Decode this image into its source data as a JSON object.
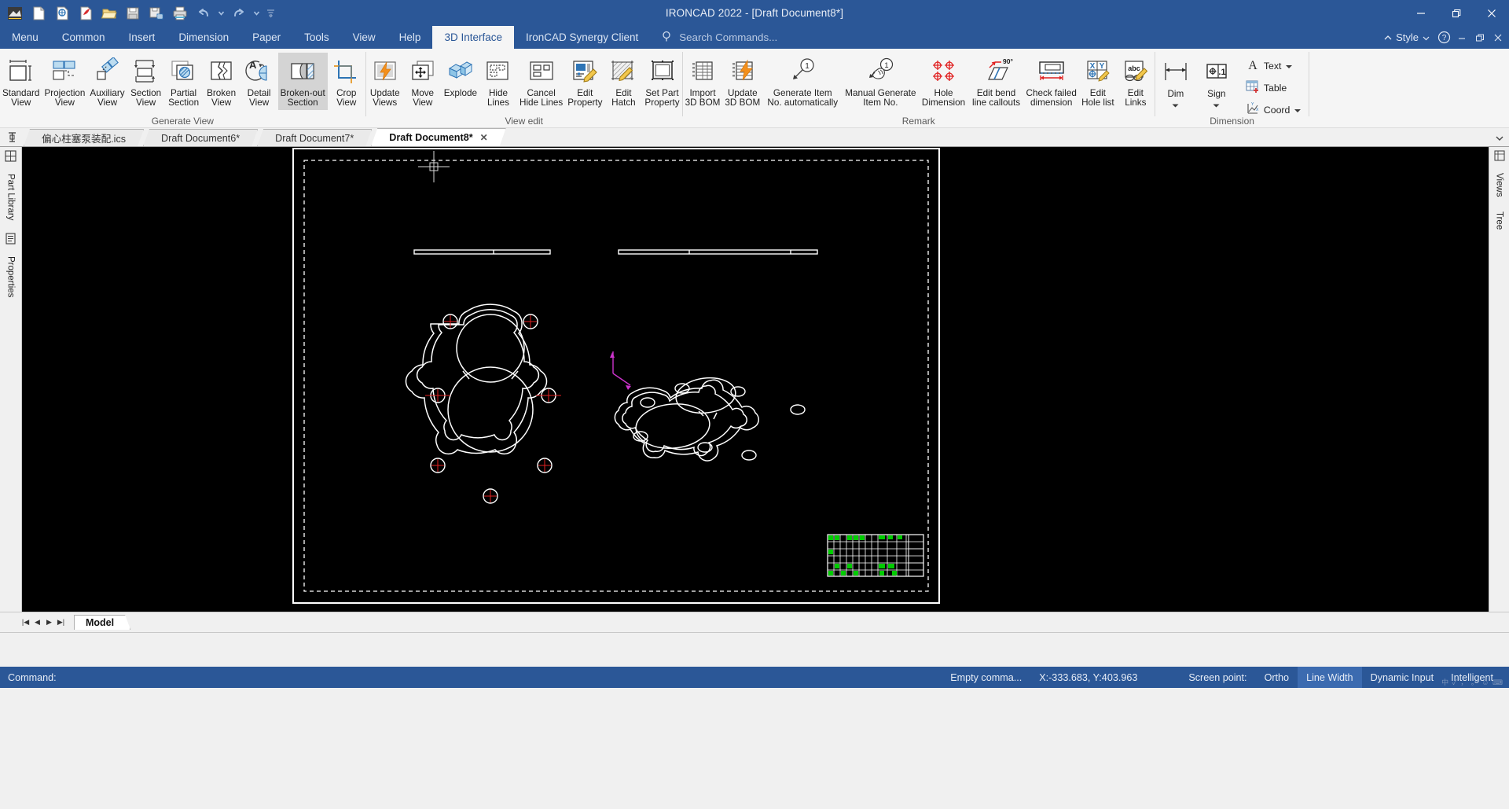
{
  "window": {
    "title": "IRONCAD 2022 - [Draft Document8*]",
    "minimize": "–",
    "restore": "❐",
    "close": "✕"
  },
  "quick_access": [
    {
      "name": "app-logo-icon",
      "label": "IronCAD"
    },
    {
      "name": "new-document-icon",
      "label": "New"
    },
    {
      "name": "new-drawing-icon",
      "label": "New Drawing"
    },
    {
      "name": "new-sheet-icon",
      "label": "New Sheet"
    },
    {
      "name": "open-folder-icon",
      "label": "Open"
    },
    {
      "name": "save-icon",
      "label": "Save"
    },
    {
      "name": "save-as-icon",
      "label": "Save As"
    },
    {
      "name": "print-icon",
      "label": "Print"
    },
    {
      "name": "undo-icon",
      "label": "Undo"
    },
    {
      "name": "undo-dropdown-icon",
      "label": "Undo History"
    },
    {
      "name": "redo-icon",
      "label": "Redo"
    },
    {
      "name": "redo-dropdown-icon",
      "label": "Redo History"
    },
    {
      "name": "customize-qat-icon",
      "label": "Customize Quick Access Toolbar"
    }
  ],
  "menubar": {
    "items": [
      {
        "label": "Menu",
        "active": false
      },
      {
        "label": "Common",
        "active": false
      },
      {
        "label": "Insert",
        "active": false
      },
      {
        "label": "Dimension",
        "active": false
      },
      {
        "label": "Paper",
        "active": false
      },
      {
        "label": "Tools",
        "active": false
      },
      {
        "label": "View",
        "active": false
      },
      {
        "label": "Help",
        "active": false
      },
      {
        "label": "3D Interface",
        "active": true
      },
      {
        "label": "IronCAD Synergy Client",
        "active": false
      }
    ],
    "search_placeholder": "Search Commands...",
    "style_label": "Style",
    "help_label": "?",
    "min_label": "–",
    "restore_label": "❐",
    "close_label": "✕"
  },
  "ribbon": {
    "groups": [
      {
        "label": "Generate View",
        "buttons": [
          {
            "label": "Standard\nView",
            "icon": "standard-view-icon",
            "selected": false
          },
          {
            "label": "Projection\nView",
            "icon": "projection-view-icon",
            "selected": false
          },
          {
            "label": "Auxiliary\nView",
            "icon": "auxiliary-view-icon",
            "selected": false
          },
          {
            "label": "Section\nView",
            "icon": "section-view-icon",
            "selected": false
          },
          {
            "label": "Partial\nSection",
            "icon": "partial-section-icon",
            "selected": false
          },
          {
            "label": "Broken\nView",
            "icon": "broken-view-icon",
            "selected": false
          },
          {
            "label": "Detail\nView",
            "icon": "detail-view-icon",
            "selected": false
          },
          {
            "label": "Broken-out\nSection",
            "icon": "broken-out-section-icon",
            "selected": true
          },
          {
            "label": "Crop\nView",
            "icon": "crop-view-icon",
            "selected": false
          }
        ]
      },
      {
        "label": "View edit",
        "buttons": [
          {
            "label": "Update\nViews",
            "icon": "update-views-icon",
            "selected": false
          },
          {
            "label": "Move\nView",
            "icon": "move-view-icon",
            "selected": false
          },
          {
            "label": "Explode",
            "icon": "explode-icon",
            "selected": false
          },
          {
            "label": "Hide\nLines",
            "icon": "hide-lines-icon",
            "selected": false
          },
          {
            "label": "Cancel\nHide Lines",
            "icon": "cancel-hide-lines-icon",
            "selected": false
          },
          {
            "label": "Edit\nProperty",
            "icon": "edit-property-icon",
            "selected": false
          },
          {
            "label": "Edit\nHatch",
            "icon": "edit-hatch-icon",
            "selected": false
          },
          {
            "label": "Set Part\nProperty",
            "icon": "set-part-property-icon",
            "selected": false
          }
        ]
      },
      {
        "label": "Remark",
        "buttons": [
          {
            "label": "Import\n3D BOM",
            "icon": "import-3d-bom-icon",
            "selected": false
          },
          {
            "label": "Update\n3D BOM",
            "icon": "update-3d-bom-icon",
            "selected": false
          },
          {
            "label": "Generate Item\nNo. automatically",
            "icon": "generate-item-no-icon",
            "selected": false
          },
          {
            "label": "Manual Generate\nItem No.",
            "icon": "manual-generate-item-no-icon",
            "selected": false
          },
          {
            "label": "Hole\nDimension",
            "icon": "hole-dimension-icon",
            "selected": false
          },
          {
            "label": "Edit bend\nline callouts",
            "icon": "edit-bend-line-callouts-icon",
            "selected": false
          },
          {
            "label": "Check failed\ndimension",
            "icon": "check-failed-dimension-icon",
            "selected": false
          },
          {
            "label": "Edit\nHole list",
            "icon": "edit-hole-list-icon",
            "selected": false
          },
          {
            "label": "Edit\nLinks",
            "icon": "edit-links-icon",
            "selected": false
          }
        ]
      },
      {
        "label": "Dimension",
        "buttons": [
          {
            "label": "Dim",
            "icon": "dim-icon",
            "dropdown": true,
            "selected": false
          },
          {
            "label": "Sign",
            "icon": "sign-icon",
            "dropdown": true,
            "selected": false
          }
        ],
        "small_buttons": [
          {
            "label": "Text",
            "icon": "text-icon",
            "dropdown": true
          },
          {
            "label": "Table",
            "icon": "table-icon",
            "dropdown": false
          },
          {
            "label": "Coord",
            "icon": "coord-icon",
            "dropdown": true
          }
        ]
      }
    ]
  },
  "doc_tabs": {
    "items": [
      {
        "label": "偏心柱塞泵装配.ics",
        "active": false,
        "closable": false
      },
      {
        "label": "Draft Document6*",
        "active": false,
        "closable": false
      },
      {
        "label": "Draft Document7*",
        "active": false,
        "closable": false
      },
      {
        "label": "Draft Document8*",
        "active": true,
        "closable": true
      }
    ],
    "close_glyph": "✕"
  },
  "left_rail": {
    "items": [
      {
        "label": "Part Library",
        "icon": "part-library-icon"
      },
      {
        "label": "Properties",
        "icon": "properties-icon"
      }
    ]
  },
  "right_rail": {
    "items": [
      {
        "label": "Views",
        "icon": "views-icon"
      },
      {
        "label": "Tree",
        "icon": "tree-icon"
      }
    ]
  },
  "model_bar": {
    "nav": [
      "|◀",
      "◀",
      "▶",
      "▶|"
    ],
    "tab_label": "Model"
  },
  "statusbar": {
    "command_label": "Command:",
    "command_value": "",
    "empty_command": "Empty comma...",
    "coordinates": "X:-333.683, Y:403.963",
    "screen_point": "Screen point:",
    "ortho": "Ortho",
    "line_width": "Line Width",
    "dynamic_input": "Dynamic Input",
    "intelligent": "Intelligent",
    "ime_text": "中 ✓ ， 。 ☺ ⌨"
  },
  "canvas": {
    "background": "#000000",
    "sheet_border_color": "#ffffff",
    "geometry_color": "#ffffff",
    "centermark_color": "#ff0000",
    "axis_color": "#cc33cc",
    "title_block_color": "#00cc00",
    "crosshair_color": "#cccccc"
  },
  "colors": {
    "brand_blue": "#2b5797",
    "ribbon_bg": "#f5f5f5",
    "accent_orange": "#f3901d",
    "icon_blue": "#2e74b5",
    "light_blue": "#bcdcf0",
    "red": "#e02020"
  }
}
